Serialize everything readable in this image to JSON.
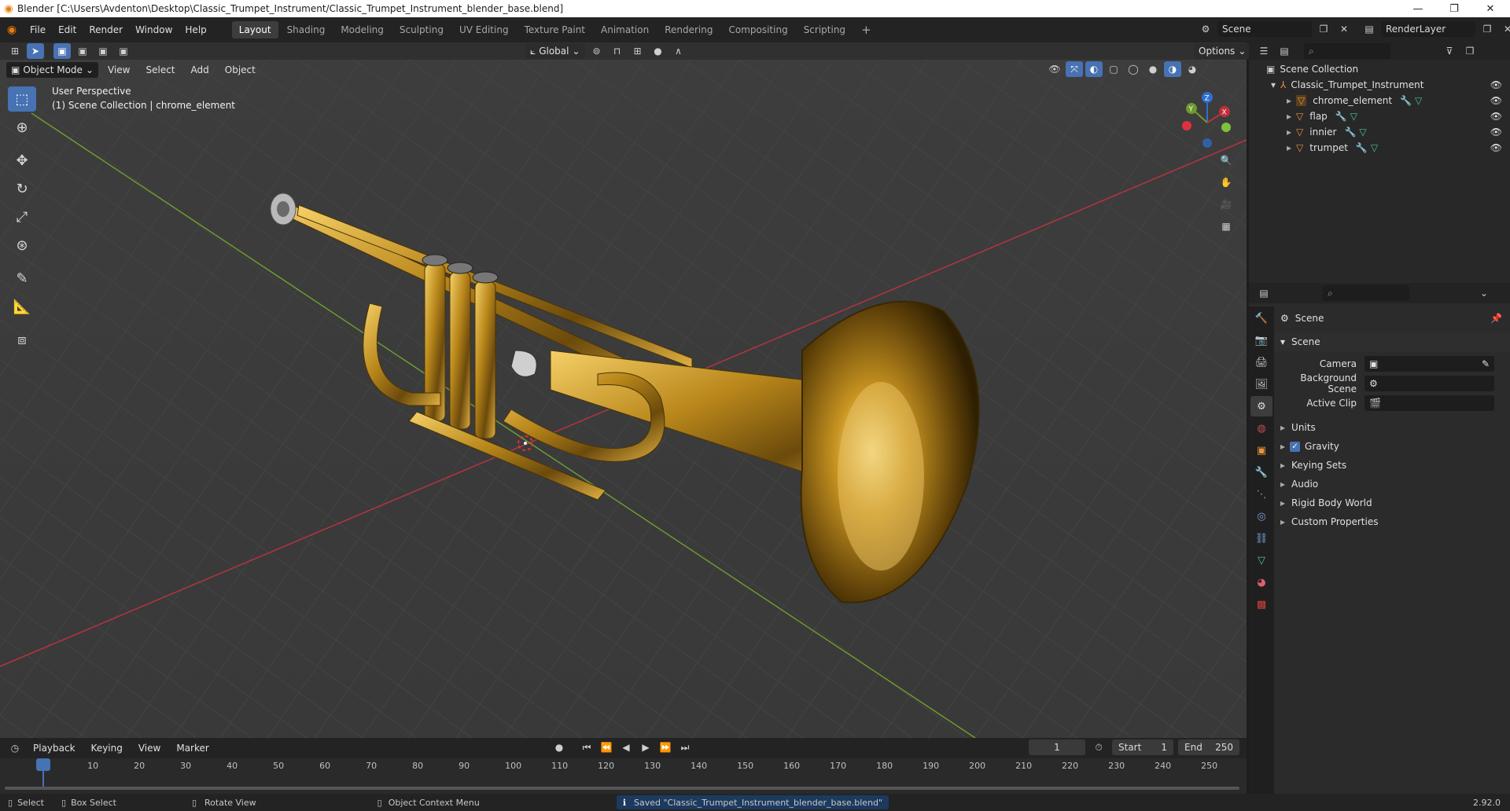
{
  "window": {
    "title": "Blender [C:\\Users\\Avdenton\\Desktop\\Classic_Trumpet_Instrument/Classic_Trumpet_Instrument_blender_base.blend]",
    "controls": [
      "—",
      "❐",
      "✕"
    ]
  },
  "menu": [
    "File",
    "Edit",
    "Render",
    "Window",
    "Help"
  ],
  "workspaces": [
    "Layout",
    "Shading",
    "Modeling",
    "Sculpting",
    "UV Editing",
    "Texture Paint",
    "Animation",
    "Rendering",
    "Compositing",
    "Scripting"
  ],
  "active_workspace": "Layout",
  "scene_selector": "Scene",
  "view_layer": "RenderLayer",
  "viewport": {
    "mode": "Object Mode",
    "header_menus": [
      "View",
      "Select",
      "Add",
      "Object"
    ],
    "transform_orientation": "Global",
    "options_label": "Options",
    "overlay_line1": "User Perspective",
    "overlay_line2": "(1) Scene Collection | chrome_element",
    "gizmo_axes": [
      "Z",
      "Y",
      "X"
    ]
  },
  "outliner": {
    "root": "Scene Collection",
    "collection": "Classic_Trumpet_Instrument",
    "objects": [
      "chrome_element",
      "flap",
      "innier",
      "trumpet"
    ]
  },
  "properties": {
    "header": "Scene",
    "panel_title": "Scene",
    "fields": [
      {
        "label": "Camera",
        "value": ""
      },
      {
        "label": "Background Scene",
        "value": ""
      },
      {
        "label": "Active Clip",
        "value": ""
      }
    ],
    "sections": [
      "Units",
      "Gravity",
      "Keying Sets",
      "Audio",
      "Rigid Body World",
      "Custom Properties"
    ],
    "gravity_checked": true
  },
  "timeline": {
    "menus": [
      "Playback",
      "Keying",
      "View",
      "Marker"
    ],
    "current_frame": "1",
    "start_label": "Start",
    "start_value": "1",
    "end_label": "End",
    "end_value": "250",
    "ruler": [
      "1",
      "10",
      "20",
      "30",
      "40",
      "50",
      "60",
      "70",
      "80",
      "90",
      "100",
      "110",
      "120",
      "130",
      "140",
      "150",
      "160",
      "170",
      "180",
      "190",
      "200",
      "210",
      "220",
      "230",
      "240",
      "250"
    ]
  },
  "statusbar": {
    "select": "Select",
    "box_select": "Box Select",
    "rotate_view": "Rotate View",
    "context_menu": "Object Context Menu",
    "message": "Saved \"Classic_Trumpet_Instrument_blender_base.blend\"",
    "version": "2.92.0"
  },
  "colors": {
    "accent": "#4772b3",
    "x_axis": "#b5343f",
    "y_axis": "#6e9a2f",
    "object_orange": "#e8953a",
    "brass": "#c8951f"
  }
}
